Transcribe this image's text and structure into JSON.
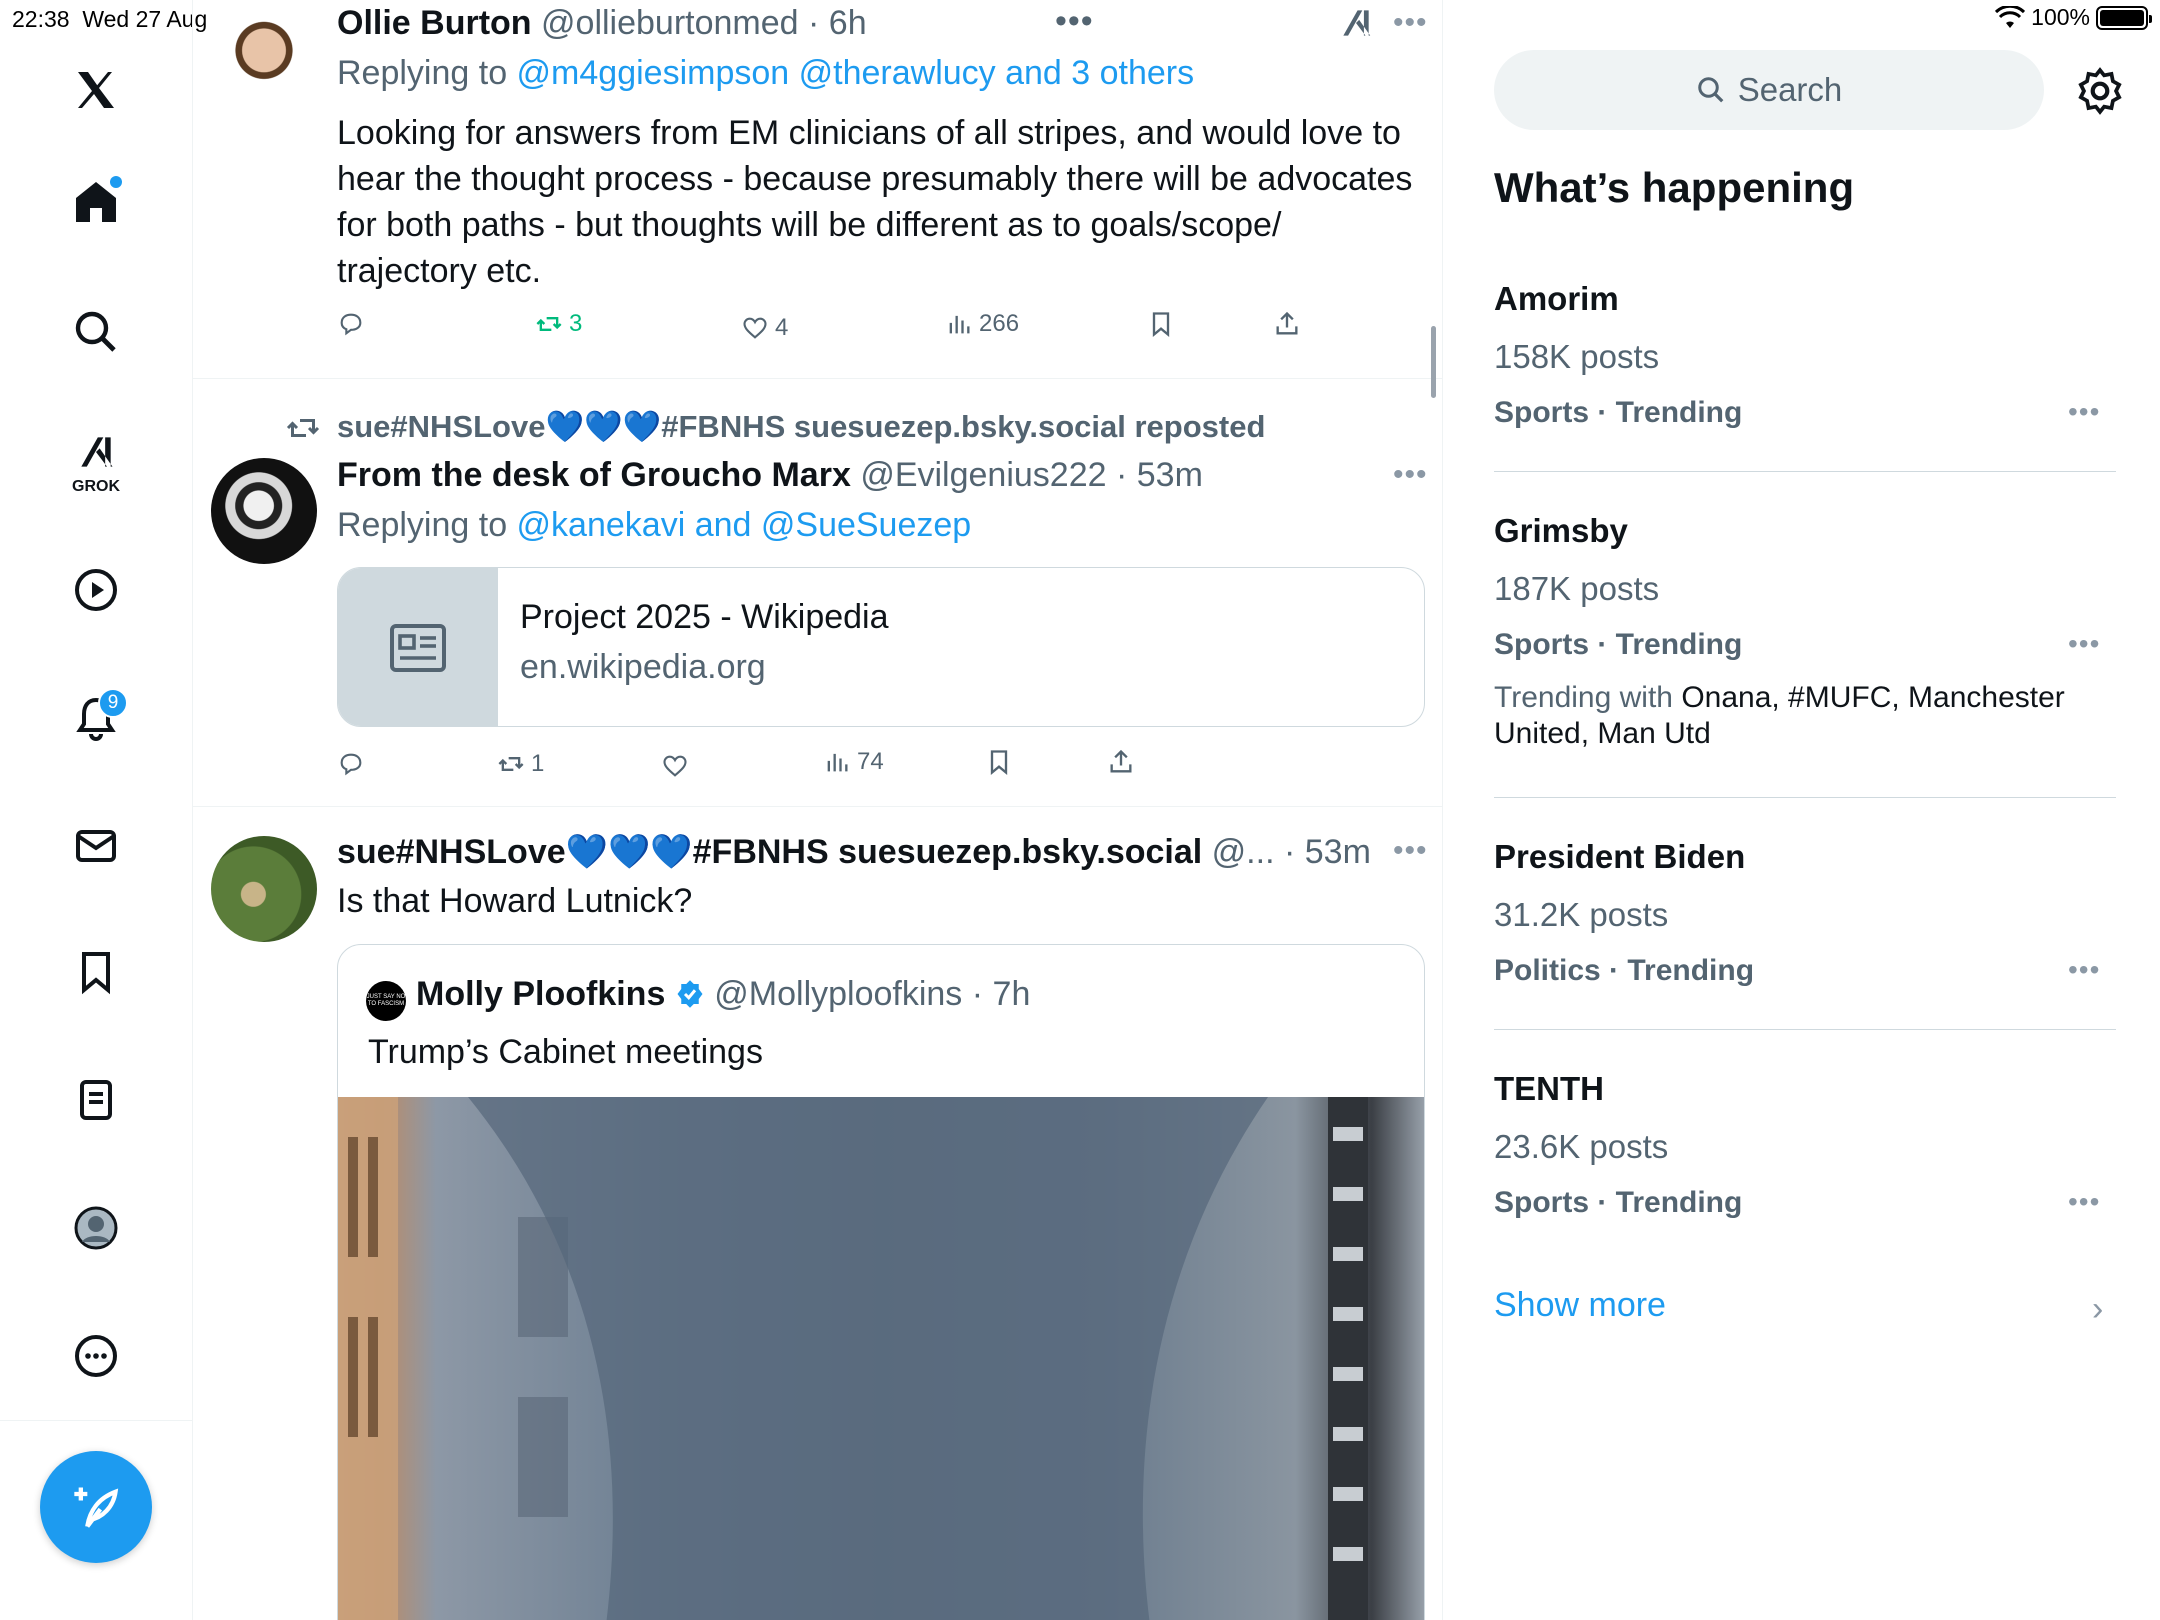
{
  "status_bar": {
    "time": "22:38",
    "date": "Wed 27 Aug",
    "battery": "100%",
    "battery_level": 1.0
  },
  "nav": {
    "grok_label": "GROK",
    "notifications_badge": "9",
    "icons": [
      "x-logo-icon",
      "home-icon",
      "search-icon",
      "grok-icon",
      "video-icon",
      "notifications-icon",
      "messages-icon",
      "bookmarks-icon",
      "lists-icon",
      "profile-icon",
      "more-icon",
      "compose-icon"
    ]
  },
  "tweets": [
    {
      "name": "Ollie Burton",
      "handle": "@ollieburtonmed",
      "time": "· 6h",
      "replying_prefix": "Replying to ",
      "replying_to": "@m4ggiesimpson @therawlucy and 3 others",
      "text": "Looking for answers from EM clinicians of all stripes, and would love to hear the thought process - because presumably there will be advocates for both paths - but thoughts will be different as to goals/scope/ trajectory etc.",
      "retweets": "3",
      "likes": "4",
      "views": "266"
    },
    {
      "repost_label": "sue#NHSLove💙💙💙#FBNHS suesuezep.bsky.social reposted",
      "name": "From the desk of Groucho Marx",
      "handle": "@Evilgenius222",
      "time": "· 53m",
      "replying_prefix": "Replying to ",
      "replying_to": "@kanekavi and @SueSuezep",
      "card_title": "Project 2025 - Wikipedia",
      "card_domain": "en.wikipedia.org",
      "retweets": "1",
      "views": "74"
    },
    {
      "name": "sue#NHSLove💙💙💙#FBNHS suesuezep.bsky.social",
      "handle": "@...",
      "time": "· 53m",
      "text": "Is that Howard Lutnick?",
      "quote": {
        "name": "Molly Ploofkins",
        "handle": "@Mollyploofkins",
        "time": "· 7h",
        "text": "Trump’s Cabinet meetings",
        "avatar_text": "JUST SAY NO TO FASCISM"
      }
    }
  ],
  "sidebar": {
    "search_placeholder": "Search",
    "section_title": "What’s happening",
    "trends": [
      {
        "name": "Amorim",
        "posts": "158K posts",
        "meta": "Sports · Trending"
      },
      {
        "name": "Grimsby",
        "posts": "187K posts",
        "meta": "Sports · Trending",
        "with_prefix": "Trending with ",
        "with": "Onana, #MUFC, Manchester United, Man Utd"
      },
      {
        "name": "President Biden",
        "posts": "31.2K posts",
        "meta": "Politics · Trending"
      },
      {
        "name": "TENTH",
        "posts": "23.6K posts",
        "meta": "Sports · Trending"
      }
    ],
    "show_more": "Show more"
  },
  "colors": {
    "accent": "#1d9bf0",
    "retweet_green": "#00ba7c",
    "muted": "#536471"
  }
}
